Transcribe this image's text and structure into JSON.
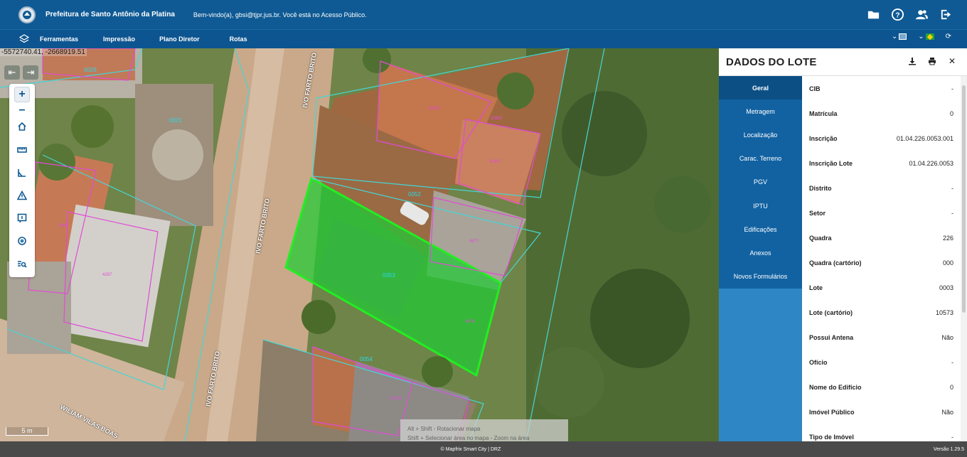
{
  "header": {
    "org_name": "Prefeitura de Santo Antônio da Platina",
    "welcome": "Bem-vindo(a), gbsi@tjpr.jus.br. Você está no Acesso Público.",
    "icons": [
      "folder-icon",
      "help-icon",
      "users-icon",
      "logout-icon"
    ]
  },
  "menu": {
    "items": [
      "Ferramentas",
      "Impressão",
      "Plano Diretor",
      "Rotas"
    ]
  },
  "map": {
    "coords": "-5572740.41, -2668919.51",
    "scale_label": "5 m",
    "hint_line1": "Alt + Shift - Rotacionar mapa",
    "hint_line2": "Shift + Selecionar área no mapa - Zoom na área selecionada",
    "streets": [
      "IVO FARTO BRITO",
      "IVO FARTO BRITO",
      "IVO FARTO BRITO",
      "WILIAM VILAS BOAS"
    ],
    "lot_labels": [
      "0026",
      "0021",
      "2686",
      "4287",
      "31454",
      "33982",
      "31457",
      "0052",
      "4877",
      "0053",
      "4678",
      "0054",
      "31453"
    ]
  },
  "panel": {
    "title": "DADOS DO LOTE",
    "tabs": [
      "Geral",
      "Metragem",
      "Localização",
      "Carac. Terreno",
      "PGV",
      "IPTU",
      "Edificações",
      "Anexos",
      "Novos Formulários"
    ],
    "fields": [
      {
        "label": "CIB",
        "value": "-"
      },
      {
        "label": "Matrícula",
        "value": "0"
      },
      {
        "label": "Inscrição",
        "value": "01.04.226.0053.001"
      },
      {
        "label": "Inscrição Lote",
        "value": "01.04.226.0053"
      },
      {
        "label": "Distrito",
        "value": "-"
      },
      {
        "label": "Setor",
        "value": "-"
      },
      {
        "label": "Quadra",
        "value": "226"
      },
      {
        "label": "Quadra (cartório)",
        "value": "000"
      },
      {
        "label": "Lote",
        "value": "0003"
      },
      {
        "label": "Lote (cartório)",
        "value": "10573"
      },
      {
        "label": "Possui Antena",
        "value": "Não"
      },
      {
        "label": "Ofício",
        "value": "-"
      },
      {
        "label": "Nome do Edifício",
        "value": "0"
      },
      {
        "label": "Imóvel Público",
        "value": "Não"
      },
      {
        "label": "Tipo de Imóvel",
        "value": "-"
      }
    ]
  },
  "footer": {
    "credit": "© Mapfrix Smart City | DRZ",
    "version": "Versão 1.29.5"
  },
  "colors": {
    "header_blue": "#0f5a94",
    "tab_blue": "#1262a2",
    "selected_lot": "#22ee22"
  }
}
